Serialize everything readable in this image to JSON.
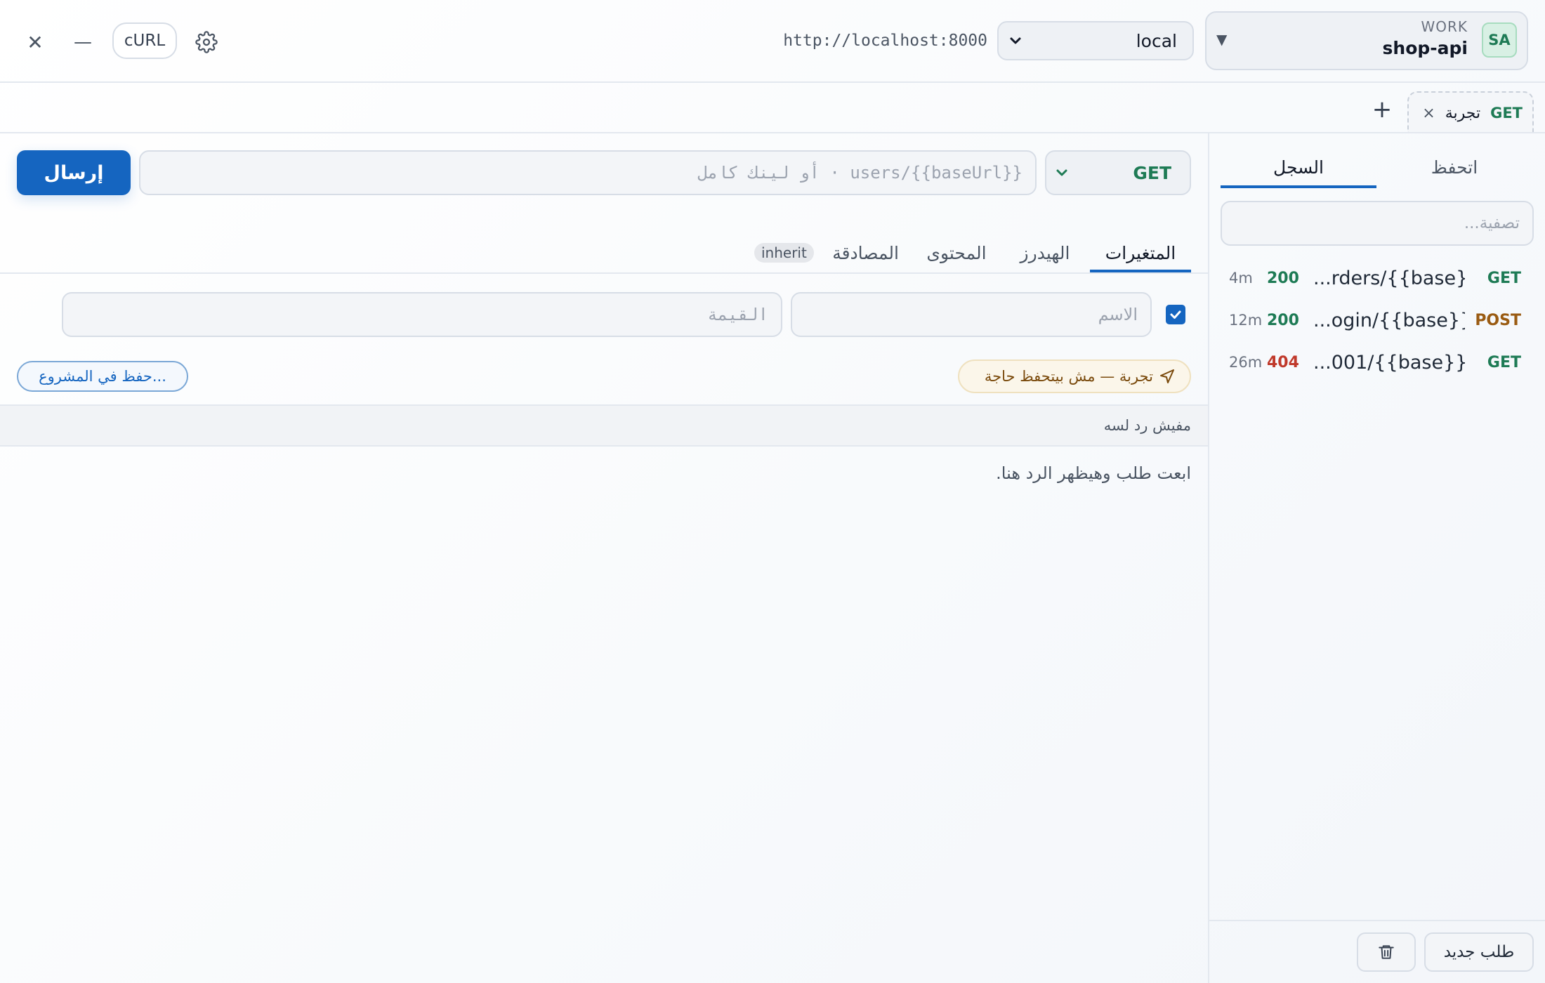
{
  "header": {
    "close_label": "✕",
    "minimize_label": "—",
    "curl_label": "cURL",
    "settings_icon": "gear-icon",
    "base_url": "http://localhost:8000",
    "environment": {
      "selected": "local"
    },
    "workspace": {
      "caption": "WORK",
      "name": "shop-api",
      "avatar": "SA"
    }
  },
  "tabs_bar": {
    "add_label": "+",
    "open_tabs": [
      {
        "method": "GET",
        "name": "تجربة",
        "close": "×"
      }
    ]
  },
  "request": {
    "method": "GET",
    "url_placeholder": "{{baseUrl}}/users  ·  أو لينك كامل",
    "send_label": "إرسال",
    "tabs": [
      {
        "label": "المتغيرات",
        "active": true
      },
      {
        "label": "الهيدرز"
      },
      {
        "label": "المحتوى"
      },
      {
        "label": "المصادقة",
        "badge": "inherit"
      }
    ],
    "params": {
      "name_placeholder": "الاسم",
      "value_placeholder": "القيمة",
      "enabled": true
    },
    "draft_notice": "تجربة — مش بيتحفظ حاجة",
    "save_to_project_label": "حفظ في المشروع..."
  },
  "response": {
    "status_text": "مفيش رد لسه",
    "empty_hint": "ابعت طلب وهيظهر الرد هنا."
  },
  "sidebar": {
    "tabs": [
      {
        "label": "السجل",
        "active": true
      },
      {
        "label": "اتحفظ"
      }
    ],
    "filter_placeholder": "تصفية...",
    "history": [
      {
        "method": "GET",
        "url": "{{base}}/orders...",
        "url_display": "...rders/{{base}}",
        "status": "200",
        "time": "4m"
      },
      {
        "method": "POST",
        "url": "{{base}}/login...",
        "url_display": "...ogin/{{base}}",
        "status": "200",
        "time": "12m"
      },
      {
        "method": "GET",
        "url": "{{base}}/001...",
        "url_display": "...001/{{base}}",
        "status": "404",
        "time": "26m"
      }
    ],
    "new_request_label": "طلب جديد",
    "trash_icon": "trash-icon"
  },
  "colors": {
    "accent": "#1565c0",
    "get": "#1e7b55",
    "post": "#9a5b12",
    "ok": "#1e7b55",
    "error": "#c0392b"
  }
}
